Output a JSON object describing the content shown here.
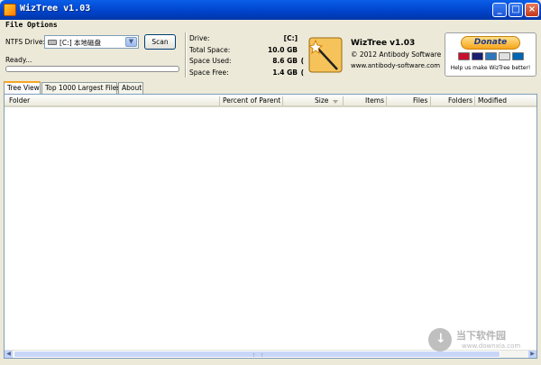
{
  "window": {
    "title": "WizTree v1.03",
    "minimize": "_",
    "maximize": "□",
    "close": "×"
  },
  "menu": {
    "file": "File",
    "options": "Options"
  },
  "scan": {
    "ntfs_label": "NTFS Drive:",
    "drive_value": "[C:] 本地磁盘",
    "dropdown_glyph": "▼",
    "scan_label": "Scan",
    "status": "Ready...",
    "progress": 0
  },
  "drive_info": {
    "drive_label": "Drive:",
    "drive_value": "[C:]",
    "total_label": "Total Space:",
    "total_value": "10.0 GB",
    "used_label": "Space Used:",
    "used_value": "8.6 GB",
    "used_trail": "(",
    "free_label": "Space Free:",
    "free_value": "1.4 GB",
    "free_trail": "("
  },
  "about": {
    "name": "WizTree v1.03",
    "copyright": "© 2012 Antibody Software",
    "url": "www.antibody-software.com"
  },
  "donate": {
    "label": "Donate",
    "caption": "Help us make WizTree better!",
    "card_colors": [
      "#c8102e",
      "#1a1f71",
      "#2e77bb",
      "#e0e0e0",
      "#0066b2"
    ]
  },
  "tabs": [
    {
      "label": "Tree View",
      "active": true
    },
    {
      "label": "Top 1000 Largest Files",
      "active": false
    },
    {
      "label": "About",
      "active": false
    }
  ],
  "columns": {
    "folder": "Folder",
    "percent": "Percent of Parent",
    "size": "Size",
    "items": "Items",
    "files": "Files",
    "folders": "Folders",
    "modified": "Modified"
  },
  "scroll": {
    "left": "◀",
    "right": "▶"
  },
  "watermark": {
    "title": "当下软件园",
    "sub": "www.downxia.com",
    "arrow": "↓"
  }
}
